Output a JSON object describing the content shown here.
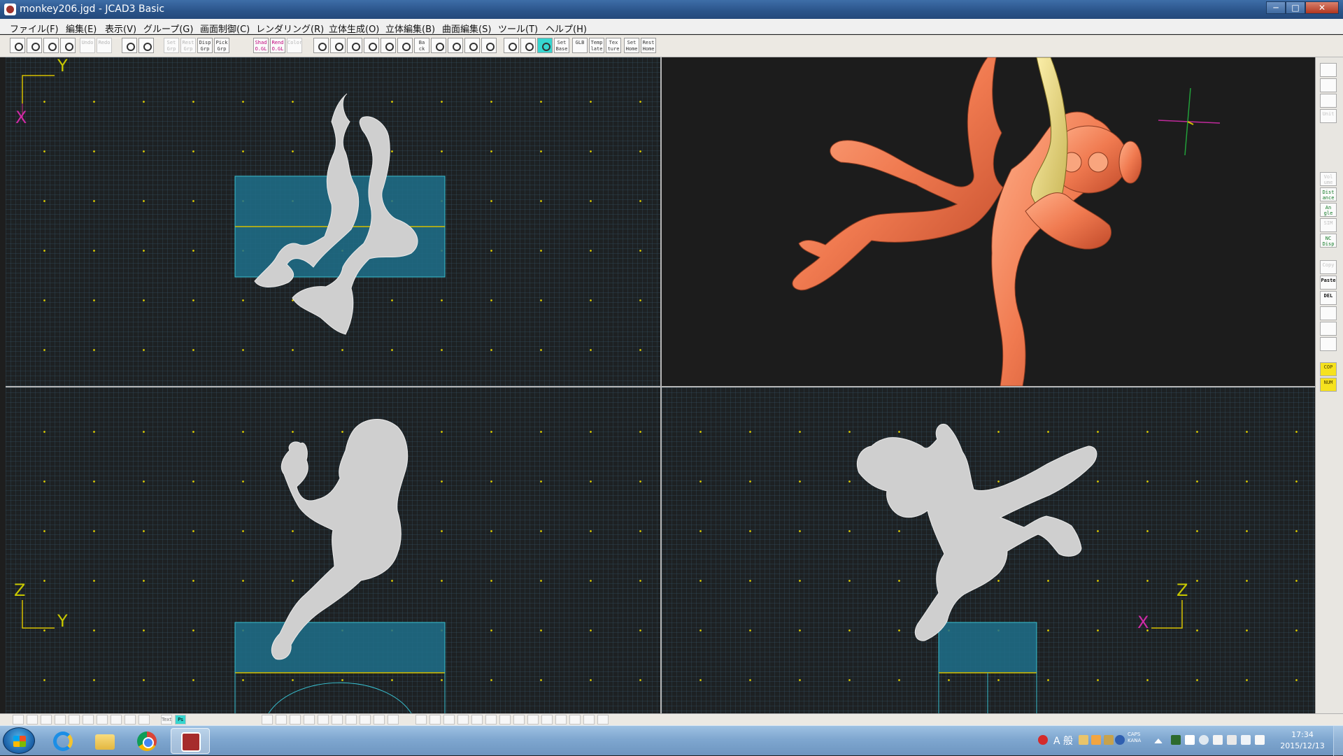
{
  "window": {
    "title": "monkey206.jgd - JCAD3 Basic",
    "controls": {
      "minimize": "─",
      "maximize": "□",
      "close": "✕"
    }
  },
  "menu": [
    "ファイル(F)",
    "編集(E)",
    "表示(V)",
    "グループ(G)",
    "画面制御(C)",
    "レンダリング(R)",
    "立体生成(O)",
    "立体編集(B)",
    "曲面編集(S)",
    "ツール(T)",
    "ヘルプ(H)"
  ],
  "toolbar": {
    "buttons": [
      {
        "name": "new-file",
        "label": ""
      },
      {
        "name": "open-file",
        "label": ""
      },
      {
        "name": "save-file",
        "label": ""
      },
      {
        "name": "print",
        "label": ""
      },
      {
        "name": "undo",
        "label": "Undo"
      },
      {
        "name": "redo",
        "label": "Redo"
      },
      {
        "name": "group-view",
        "label": ""
      },
      {
        "name": "layout",
        "label": ""
      },
      {
        "name": "set-group",
        "label": "Set Grp"
      },
      {
        "name": "reset-group",
        "label": "Rest Grp"
      },
      {
        "name": "display-group",
        "label": "Disp Grp"
      },
      {
        "name": "pick-group",
        "label": "Pick Grp"
      },
      {
        "name": "shade-opengl",
        "label": "Shad O.GL"
      },
      {
        "name": "render-opengl",
        "label": "Rend O.GL"
      },
      {
        "name": "color",
        "label": "Color"
      },
      {
        "name": "zoom-in",
        "label": ""
      },
      {
        "name": "zoom-out",
        "label": ""
      },
      {
        "name": "zoom-all",
        "label": ""
      },
      {
        "name": "zoom-window",
        "label": ""
      },
      {
        "name": "zoom-fit",
        "label": ""
      },
      {
        "name": "pan",
        "label": ""
      },
      {
        "name": "back",
        "label": "Ba ck"
      },
      {
        "name": "rot-x",
        "label": ""
      },
      {
        "name": "rot-y",
        "label": ""
      },
      {
        "name": "rot-z",
        "label": ""
      },
      {
        "name": "view-box",
        "label": ""
      },
      {
        "name": "grid-lines",
        "label": ""
      },
      {
        "name": "grid-dots",
        "label": ""
      },
      {
        "name": "grid-active",
        "label": ""
      },
      {
        "name": "set-base",
        "label": "Set Base"
      },
      {
        "name": "global",
        "label": "GLB"
      },
      {
        "name": "template",
        "label": "Temp late"
      },
      {
        "name": "texture",
        "label": "Tex ture"
      },
      {
        "name": "set-home",
        "label": "Set Home"
      },
      {
        "name": "reset-home",
        "label": "Rest Home"
      }
    ]
  },
  "viewports": {
    "top_left": {
      "axis_h": "Y",
      "axis_v": "X"
    },
    "top_right": {},
    "bottom_left": {
      "axis_h": "Y",
      "axis_v": "Z"
    },
    "bottom_right": {
      "axis_h": "X",
      "axis_v": "Z"
    }
  },
  "right_toolbar": [
    {
      "name": "tool-1",
      "label": ""
    },
    {
      "name": "tool-2",
      "label": ""
    },
    {
      "name": "tool-3",
      "label": ""
    },
    {
      "name": "unit",
      "label": "Unit"
    },
    {
      "name": "volume",
      "label": "Vol ume"
    },
    {
      "name": "distance",
      "label": "Dist ance"
    },
    {
      "name": "angle",
      "label": "An gle"
    },
    {
      "name": "sim",
      "label": "SIM"
    },
    {
      "name": "nc-display",
      "label": "NC Disp"
    },
    {
      "name": "copy",
      "label": "Copy"
    },
    {
      "name": "paste",
      "label": "Paste"
    },
    {
      "name": "delete",
      "label": "DEL"
    },
    {
      "name": "tool-13",
      "label": ""
    },
    {
      "name": "tool-14",
      "label": ""
    },
    {
      "name": "tool-15",
      "label": ""
    },
    {
      "name": "cop",
      "label": "COP"
    },
    {
      "name": "num",
      "label": "NUM"
    }
  ],
  "bottom_toolbar": {
    "text_label": "Text",
    "active_label": "Ps"
  },
  "taskbar": {
    "ime_mode": "A 般",
    "caps_label": "CAPS",
    "kana_label": "KANA",
    "clock_time": "17:34",
    "clock_date": "2015/12/13"
  }
}
